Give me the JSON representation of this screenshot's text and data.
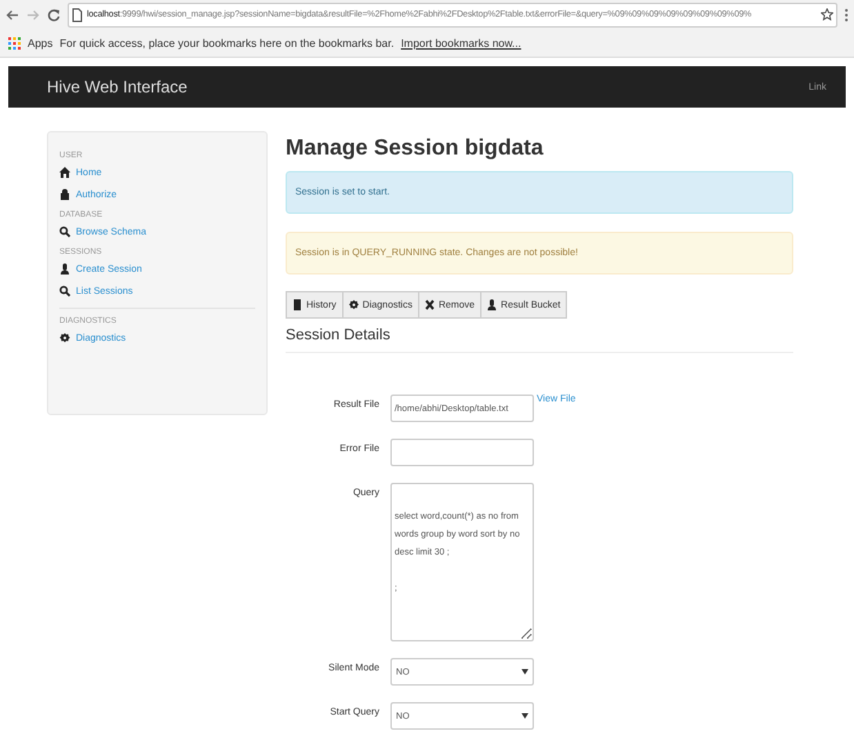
{
  "browser": {
    "url_host": "localhost",
    "url_rest": ":9999/hwi/session_manage.jsp?sessionName=bigdata&resultFile=%2Fhome%2Fabhi%2FDesktop%2Ftable.txt&errorFile=&query=%09%09%09%09%09%09%09%09%",
    "apps": "Apps",
    "bookmarks_hint": "For quick access, place your bookmarks here on the bookmarks bar.",
    "import_link": "Import bookmarks now..."
  },
  "navbar": {
    "brand": "Hive Web Interface",
    "link": "Link"
  },
  "sidebar": {
    "groups": [
      {
        "header": "USER",
        "items": [
          "Home",
          "Authorize"
        ]
      },
      {
        "header": "DATABASE",
        "items": [
          "Browse Schema"
        ]
      },
      {
        "header": "SESSIONS",
        "items": [
          "Create Session",
          "List Sessions"
        ]
      },
      {
        "header": "DIAGNOSTICS",
        "items": [
          "Diagnostics"
        ]
      }
    ]
  },
  "title": "Manage Session bigdata",
  "alerts": [
    {
      "kind": "info",
      "text": "Session is set to start."
    },
    {
      "kind": "warning",
      "text": "Session is in QUERY_RUNNING state. Changes are not possible!"
    }
  ],
  "buttons": [
    "History",
    "Diagnostics",
    "Remove",
    "Result Bucket"
  ],
  "section_title": "Session Details",
  "form": [
    {
      "kind": "text",
      "label": "Result File",
      "value": "/home/abhi/Desktop/table.txt",
      "link": "View File"
    },
    {
      "kind": "text",
      "label": "Error File"
    },
    {
      "kind": "textarea",
      "label": "Query",
      "value": "\nselect word,count(*) as no from words group by word sort by no desc limit 30 ;\n\n;"
    },
    {
      "kind": "select",
      "label": "Silent Mode",
      "value": "NO"
    },
    {
      "kind": "select",
      "label": "Start Query",
      "value": "NO"
    }
  ]
}
